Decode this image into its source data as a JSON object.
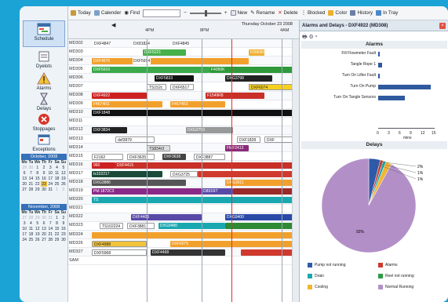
{
  "nav": {
    "items": [
      {
        "label": "Schedule"
      },
      {
        "label": "Dyelots"
      },
      {
        "label": "Alarms"
      },
      {
        "label": "Delays"
      },
      {
        "label": "Stoppages"
      },
      {
        "label": "Exceptions"
      }
    ],
    "cal1": {
      "title": "October, 2008",
      "weekdays": [
        "Mo",
        "Tu",
        "We",
        "Th",
        "Fr",
        "Sa",
        "Su"
      ],
      "days": [
        "29",
        "30",
        "1",
        "2",
        "3",
        "4",
        "5",
        "6",
        "7",
        "8",
        "9",
        "10",
        "11",
        "12",
        "13",
        "14",
        "15",
        "16",
        "17",
        "18",
        "19",
        "20",
        "21",
        "22",
        "23",
        "24",
        "25",
        "26",
        "27",
        "28",
        "29",
        "30",
        "31",
        "1",
        "2"
      ]
    },
    "cal2": {
      "title": "November, 2008",
      "weekdays": [
        "Mo",
        "Tu",
        "We",
        "Th",
        "Fr",
        "Sa",
        "Su"
      ],
      "days": [
        "27",
        "28",
        "29",
        "30",
        "31",
        "1",
        "2",
        "3",
        "4",
        "5",
        "6",
        "7",
        "8",
        "9",
        "10",
        "11",
        "12",
        "13",
        "14",
        "15",
        "16",
        "17",
        "18",
        "19",
        "20",
        "21",
        "22",
        "23",
        "24",
        "25",
        "26",
        "27",
        "28",
        "29",
        "30"
      ]
    }
  },
  "toolbar": {
    "today": "Today",
    "calendar": "Calender",
    "find": "Find",
    "new": "New",
    "rename": "Rename",
    "delete": "Delete",
    "blocked": "Blocked",
    "color": "Color",
    "history": "History",
    "in_tray": "In Tray"
  },
  "gantt": {
    "day_label": "Thursday October 23 2008",
    "times": [
      "4PM",
      "8PM",
      "4AM"
    ],
    "rows": [
      {
        "id": "MD302",
        "text": [
          "DXF4847",
          "DX81824",
          "DXF4845"
        ]
      },
      {
        "id": "MD303",
        "text": [
          "DXF5221",
          "F0953R"
        ]
      },
      {
        "id": "MD304",
        "text": [
          "DXF4675",
          "DXF5914"
        ]
      },
      {
        "id": "MD305",
        "text": [
          "DXF5916",
          "F4050K"
        ]
      },
      {
        "id": "MD306",
        "text": [
          "DXF5833",
          "DXG3798"
        ]
      },
      {
        "id": "MD307",
        "text": [
          "TS152c",
          "DXF6517",
          "DXF6074"
        ]
      },
      {
        "id": "MD308",
        "text": [
          "DXF4922",
          "F1549R8"
        ]
      },
      {
        "id": "MD309",
        "text": [
          "F4674R2",
          "F4674R3"
        ]
      },
      {
        "id": "MD310",
        "text": [
          "DXF1848"
        ]
      },
      {
        "id": "MD311",
        "text": []
      },
      {
        "id": "MD312",
        "text": [
          "DXF3834",
          "DXG3750"
        ]
      },
      {
        "id": "MD313",
        "text": [
          "dxf3879",
          "DXF1828",
          "DXF"
        ]
      },
      {
        "id": "MD314",
        "text": [
          "TS834r3",
          "FMF2413"
        ]
      },
      {
        "id": "MD315",
        "text": [
          "F2162",
          "DXF3635",
          "DXF3638",
          "DXF3887"
        ]
      },
      {
        "id": "MD316",
        "text": [
          "960",
          "DXF4415"
        ]
      },
      {
        "id": "MD317",
        "text": [
          "ts102217",
          "DXG3725"
        ]
      },
      {
        "id": "MD318",
        "text": [
          "DXG3886",
          "DXG3911"
        ]
      },
      {
        "id": "MD319",
        "text": [
          "PM 1872C3",
          "D891R7"
        ]
      },
      {
        "id": "MD320",
        "text": [
          "TS"
        ]
      },
      {
        "id": "MD321",
        "text": []
      },
      {
        "id": "MD322",
        "text": [
          "DXF4406",
          "DXG9400"
        ]
      },
      {
        "id": "MD323",
        "text": [
          "TS102224",
          "DXF3881",
          "DXG9480"
        ]
      },
      {
        "id": "MD324",
        "text": []
      },
      {
        "id": "MD326",
        "text": [
          "DXF4988",
          "DXF6075"
        ]
      },
      {
        "id": "MD327",
        "text": [
          "DXF5968",
          "DXF4498"
        ]
      },
      {
        "id": "SAM",
        "text": []
      }
    ]
  },
  "panel": {
    "title": "Alarms and Delays - DXF4922  (MD308)",
    "alarms_title": "Alarms",
    "alarm_labels": [
      "Fill Flowmeter Fault",
      "Tangle Rope 1",
      "Turn On Lifter Fault",
      "Turn On Pump",
      "Turn On Tangle Sensors"
    ],
    "axis_ticks": [
      "0",
      "3",
      "6",
      "9",
      "12",
      "15"
    ],
    "axis_label": "mins",
    "delays_title": "Delays",
    "pie_labels": [
      "2%",
      "1%",
      "1%"
    ],
    "pie_center": "92%",
    "legend": [
      "Pump not running",
      "Alarms",
      "Drain",
      "Reel not running",
      "Cooling",
      "Normal Running"
    ]
  },
  "chart_data": [
    {
      "type": "bar",
      "title": "Alarms",
      "categories": [
        "Fill Flowmeter Fault",
        "Tangle Rope 1",
        "Turn On Lifter Fault",
        "Turn On Pump",
        "Turn On Tangle Sensors"
      ],
      "values": [
        0.5,
        1,
        0.5,
        14,
        7
      ],
      "xlabel": "mins",
      "xlim": [
        0,
        15
      ]
    },
    {
      "type": "pie",
      "title": "Delays",
      "categories": [
        "Pump not running",
        "Alarms",
        "Drain",
        "Reel not running",
        "Cooling",
        "Normal Running"
      ],
      "values": [
        4,
        1,
        1,
        0,
        2,
        92
      ]
    }
  ],
  "colors": {
    "pump": "#2f5aa8",
    "alarms": "#d03a2e",
    "drain": "#1aa8b0",
    "reel": "#2e9a45",
    "cooling": "#f2b532",
    "normal": "#b38fc8"
  }
}
